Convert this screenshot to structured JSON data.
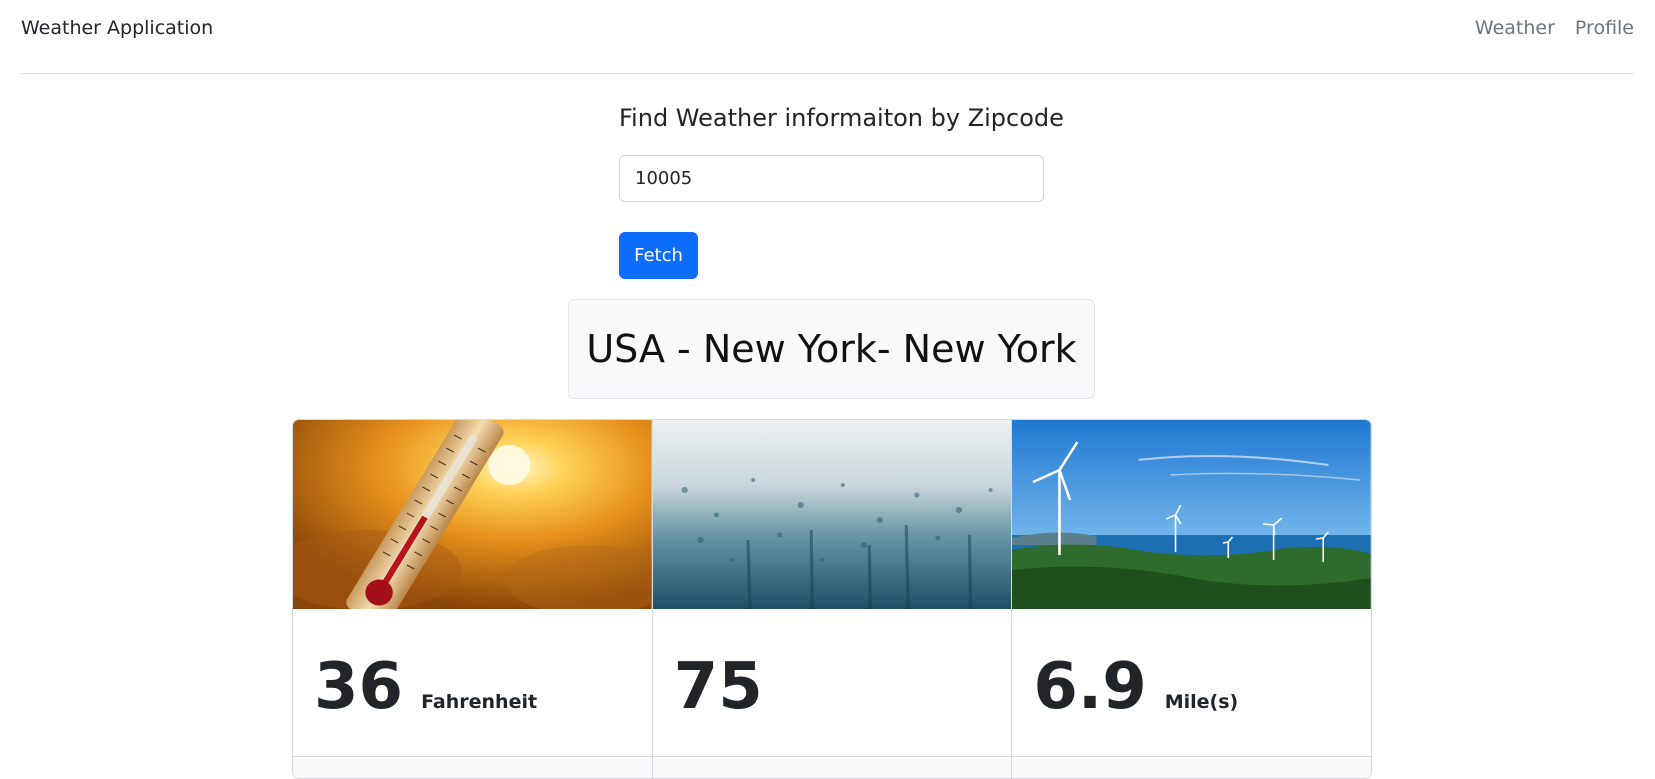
{
  "navbar": {
    "brand": "Weather Application",
    "links": [
      "Weather",
      "Profile"
    ]
  },
  "form": {
    "title": "Find Weather informaiton by Zipcode",
    "zip_value": "10005",
    "button_label": "Fetch"
  },
  "location": "USA - New York- New York",
  "cards": [
    {
      "image": "thermometer-sun-photo",
      "value": "36",
      "unit": "Fahrenheit"
    },
    {
      "image": "rain-droplets-glass-photo",
      "value": "75",
      "unit": ""
    },
    {
      "image": "wind-turbines-coast-photo",
      "value": "6.9",
      "unit": "Mile(s)"
    }
  ],
  "colors": {
    "primary": "#0d6efd",
    "nav_muted": "#6c757d",
    "text": "#212529"
  }
}
